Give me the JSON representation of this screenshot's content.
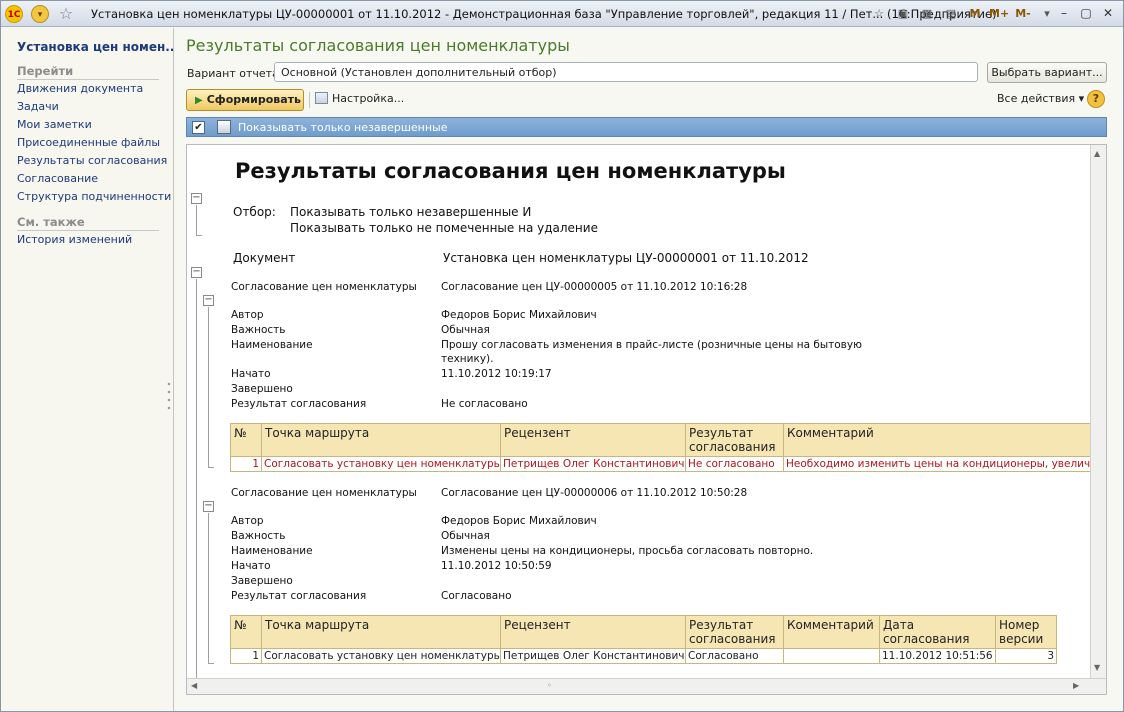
{
  "window": {
    "title": "Установка цен номенклатуры ЦУ-00000001 от 11.10.2012 - Демонстрационная база \"Управление торговлей\", редакция 11 / Пет...   (1С:Предприятие)",
    "tools": [
      "M",
      "M+",
      "M-"
    ]
  },
  "left_panel": {
    "title": "Установка цен номен...",
    "section_go": "Перейти",
    "links": [
      "Движения документа",
      "Задачи",
      "Мои заметки",
      "Присоединенные файлы",
      "Результаты согласования",
      "Согласование",
      "Структура подчиненности"
    ],
    "section_see_also": "См. также",
    "see_also_links": [
      "История изменений"
    ]
  },
  "main": {
    "title": "Результаты согласования цен номенклатуры",
    "variant_label": "Вариант отчета:",
    "variant_value": "Основной (Установлен дополнительный отбор)",
    "choose_variant_button": "Выбрать вариант...",
    "generate_button": "Сформировать",
    "settings_button": "Настройка...",
    "all_actions": "Все действия",
    "help": "?",
    "filter_checked": true,
    "filter_label": "Показывать только незавершенные"
  },
  "report": {
    "title": "Результаты согласования цен номенклатуры",
    "filter_label": "Отбор:",
    "filter_lines": [
      "Показывать только незавершенные И",
      "Показывать только не помеченные на удаление"
    ],
    "document_label": "Документ",
    "document_value": "Установка цен номенклатуры ЦУ-00000001 от 11.10.2012",
    "groups": [
      {
        "label": "Согласование цен номенклатуры",
        "value": "Согласование цен ЦУ-00000005 от 11.10.2012 10:16:28",
        "fields": [
          {
            "name": "Автор",
            "value": "Федоров Борис Михайлович"
          },
          {
            "name": "Важность",
            "value": "Обычная"
          },
          {
            "name": "Наименование",
            "value": "Прошу согласовать изменения в прайс-листе (розничные цены на бытовую",
            "value2": "технику)."
          },
          {
            "name": "Начато",
            "value": "11.10.2012 10:19:17"
          },
          {
            "name": "Завершено",
            "value": ""
          },
          {
            "name": "Результат согласования",
            "value": "Не согласовано"
          }
        ],
        "table": {
          "headers": [
            "№",
            "Точка маршрута",
            "Рецензент",
            "Результат согласования",
            "Комментарий"
          ],
          "rows": [
            [
              "1",
              "Согласовать установку цен номенклатуры",
              "Петрищев Олег Константинович",
              "Не согласовано",
              "Необходимо изменить цены на кондиционеры, увеличить н"
            ]
          ]
        }
      },
      {
        "label": "Согласование цен номенклатуры",
        "value": "Согласование цен ЦУ-00000006 от 11.10.2012 10:50:28",
        "fields": [
          {
            "name": "Автор",
            "value": "Федоров Борис Михайлович"
          },
          {
            "name": "Важность",
            "value": "Обычная"
          },
          {
            "name": "Наименование",
            "value": "Изменены цены на кондиционеры, просьба согласовать повторно."
          },
          {
            "name": "Начато",
            "value": "11.10.2012 10:50:59"
          },
          {
            "name": "Завершено",
            "value": ""
          },
          {
            "name": "Результат согласования",
            "value": "Согласовано"
          }
        ],
        "table": {
          "headers": [
            "№",
            "Точка маршрута",
            "Рецензент",
            "Результат согласования",
            "Комментарий",
            "Дата согласования",
            "Номер версии"
          ],
          "rows": [
            [
              "1",
              "Согласовать установку цен номенклатуры",
              "Петрищев Олег Константинович",
              "Согласовано",
              "",
              "11.10.2012 10:51:56",
              "3"
            ]
          ]
        }
      }
    ]
  },
  "colors": {
    "accent_title": "#4a7a2a",
    "link": "#1d3a7a",
    "warning_row": "#b0161b",
    "table_header": "#f5e6b4",
    "filter_bar": "#7ba5d2"
  }
}
